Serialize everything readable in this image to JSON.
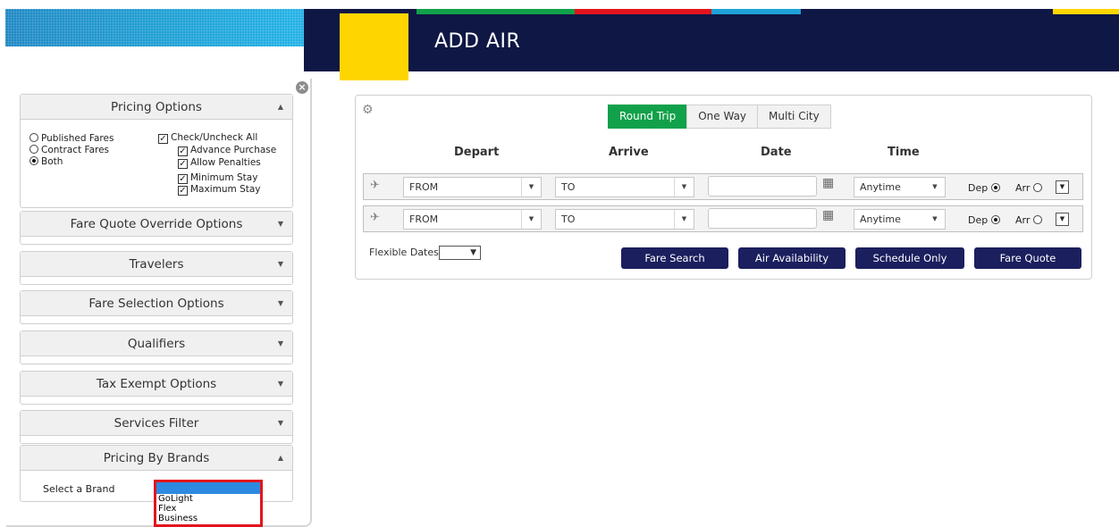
{
  "banner": {
    "title": "ADD AIR",
    "colors": {
      "navy": "#0f1745",
      "yellow": "#ffd500",
      "cyan": "#1ea2d6",
      "green": "#11a14a",
      "red": "#e3141c"
    }
  },
  "left_panel": {
    "close_icon": "close-circle-icon",
    "pricing_options": {
      "title": "Pricing Options",
      "fare_types": [
        {
          "label": "Published Fares",
          "selected": false
        },
        {
          "label": "Contract Fares",
          "selected": false
        },
        {
          "label": "Both",
          "selected": true
        }
      ],
      "check_all": "Check/Uncheck All",
      "checks": [
        "Advance Purchase",
        "Allow Penalties",
        "Minimum Stay",
        "Maximum Stay"
      ]
    },
    "sections": [
      "Fare Quote Override Options",
      "Travelers",
      "Fare Selection Options",
      "Qualifiers",
      "Tax Exempt Options",
      "Services Filter"
    ],
    "pricing_by_brands": {
      "title": "Pricing By Brands",
      "select_label": "Select a Brand",
      "options": [
        "GoLight",
        "Flex",
        "Business"
      ]
    }
  },
  "search": {
    "trip_types": [
      "Round Trip",
      "One Way",
      "Multi City"
    ],
    "active_trip": "Round Trip",
    "columns": {
      "depart": "Depart",
      "arrive": "Arrive",
      "date": "Date",
      "time": "Time"
    },
    "legs": [
      {
        "from": "FROM",
        "to": "TO",
        "time": "Anytime",
        "dep_label": "Dep",
        "arr_label": "Arr",
        "icon": "takeoff-icon"
      },
      {
        "from": "FROM",
        "to": "TO",
        "time": "Anytime",
        "dep_label": "Dep",
        "arr_label": "Arr",
        "icon": "landing-icon"
      }
    ],
    "flexible_dates_label": "Flexible Dates",
    "buttons": {
      "fare_search": "Fare Search",
      "air_availability": "Air Availability",
      "schedule_only": "Schedule Only",
      "fare_quote": "Fare Quote"
    }
  }
}
